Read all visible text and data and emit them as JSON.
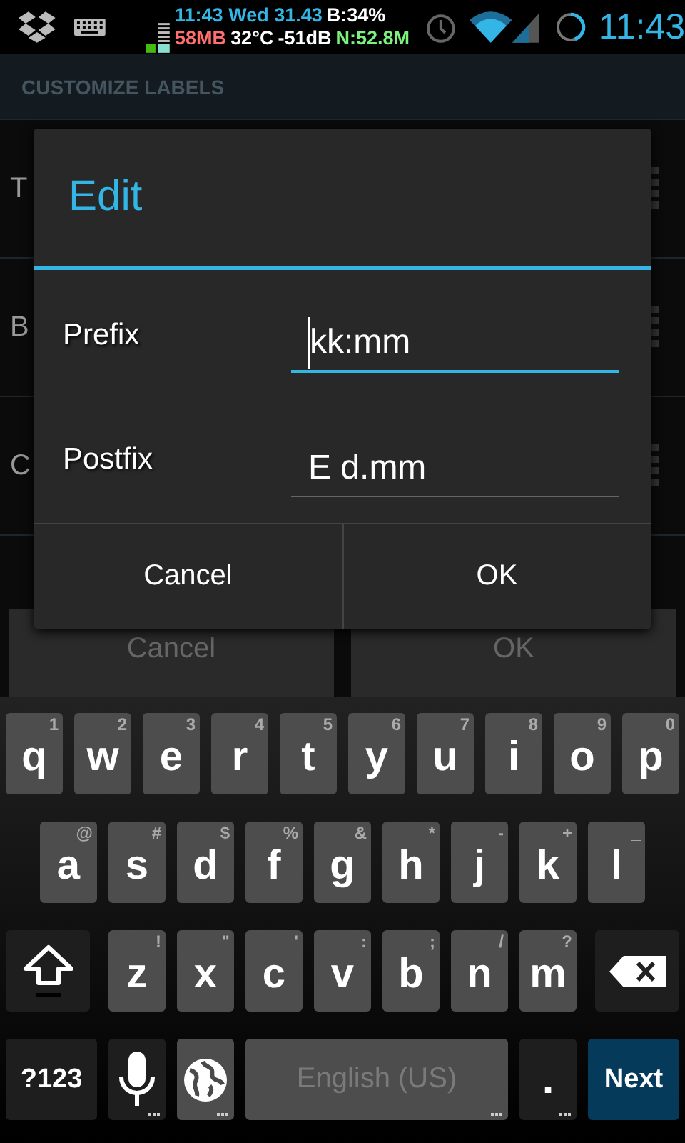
{
  "status_bar": {
    "line_1": [
      {
        "text": "11:43 Wed 31.43",
        "color": "#33b5e5"
      },
      {
        "text": "B:34%",
        "color": "#ffffff"
      }
    ],
    "line_2": [
      {
        "text": "58MB",
        "color": "#ff6f6f"
      },
      {
        "text": "32°C",
        "color": "#ffffff"
      },
      {
        "text": "-51dB",
        "color": "#ffffff"
      },
      {
        "text": "N:52.8M",
        "color": "#7cf27c"
      }
    ],
    "clock": "11:43"
  },
  "header": {
    "title": "CUSTOMIZE LABELS"
  },
  "list_items": [
    {
      "label": "T"
    },
    {
      "label": "B"
    },
    {
      "label": "C"
    }
  ],
  "footer_buttons": [
    {
      "label": "Cancel"
    },
    {
      "label": "OK"
    }
  ],
  "dialog": {
    "title": "Edit",
    "fields": [
      {
        "label": "Prefix",
        "value": "kk:mm",
        "focused": true
      },
      {
        "label": "Postfix",
        "value": "E d.mm",
        "focused": false
      }
    ],
    "buttons": [
      {
        "label": "Cancel"
      },
      {
        "label": "OK"
      }
    ]
  },
  "keyboard": {
    "rows": [
      {
        "keys": [
          {
            "kind": "letter",
            "label": "q",
            "hint": "1"
          },
          {
            "kind": "letter",
            "label": "w",
            "hint": "2"
          },
          {
            "kind": "letter",
            "label": "e",
            "hint": "3"
          },
          {
            "kind": "letter",
            "label": "r",
            "hint": "4"
          },
          {
            "kind": "letter",
            "label": "t",
            "hint": "5"
          },
          {
            "kind": "letter",
            "label": "y",
            "hint": "6"
          },
          {
            "kind": "letter",
            "label": "u",
            "hint": "7"
          },
          {
            "kind": "letter",
            "label": "i",
            "hint": "8"
          },
          {
            "kind": "letter",
            "label": "o",
            "hint": "9"
          },
          {
            "kind": "letter",
            "label": "p",
            "hint": "0"
          }
        ]
      },
      {
        "keys": [
          {
            "kind": "letter",
            "label": "a",
            "hint": "@"
          },
          {
            "kind": "letter",
            "label": "s",
            "hint": "#"
          },
          {
            "kind": "letter",
            "label": "d",
            "hint": "$"
          },
          {
            "kind": "letter",
            "label": "f",
            "hint": "%"
          },
          {
            "kind": "letter",
            "label": "g",
            "hint": "&"
          },
          {
            "kind": "letter",
            "label": "h",
            "hint": "*"
          },
          {
            "kind": "letter",
            "label": "j",
            "hint": "-"
          },
          {
            "kind": "letter",
            "label": "k",
            "hint": "+"
          },
          {
            "kind": "letter",
            "label": "l",
            "hint": "_"
          }
        ]
      },
      {
        "keys": [
          {
            "kind": "shift"
          },
          {
            "kind": "letter",
            "label": "z",
            "hint": "!"
          },
          {
            "kind": "letter",
            "label": "x",
            "hint": "\""
          },
          {
            "kind": "letter",
            "label": "c",
            "hint": "'"
          },
          {
            "kind": "letter",
            "label": "v",
            "hint": ":"
          },
          {
            "kind": "letter",
            "label": "b",
            "hint": ";"
          },
          {
            "kind": "letter",
            "label": "n",
            "hint": "/"
          },
          {
            "kind": "letter",
            "label": "m",
            "hint": "?"
          },
          {
            "kind": "backspace"
          }
        ]
      },
      {
        "keys": [
          {
            "kind": "symbols",
            "label": "?123"
          },
          {
            "kind": "mic",
            "more": true
          },
          {
            "kind": "globe",
            "more": true
          },
          {
            "kind": "space",
            "label": "English (US)",
            "more": true
          },
          {
            "kind": "period",
            "label": ".",
            "more": true
          },
          {
            "kind": "action",
            "label": "Next"
          }
        ]
      }
    ]
  }
}
